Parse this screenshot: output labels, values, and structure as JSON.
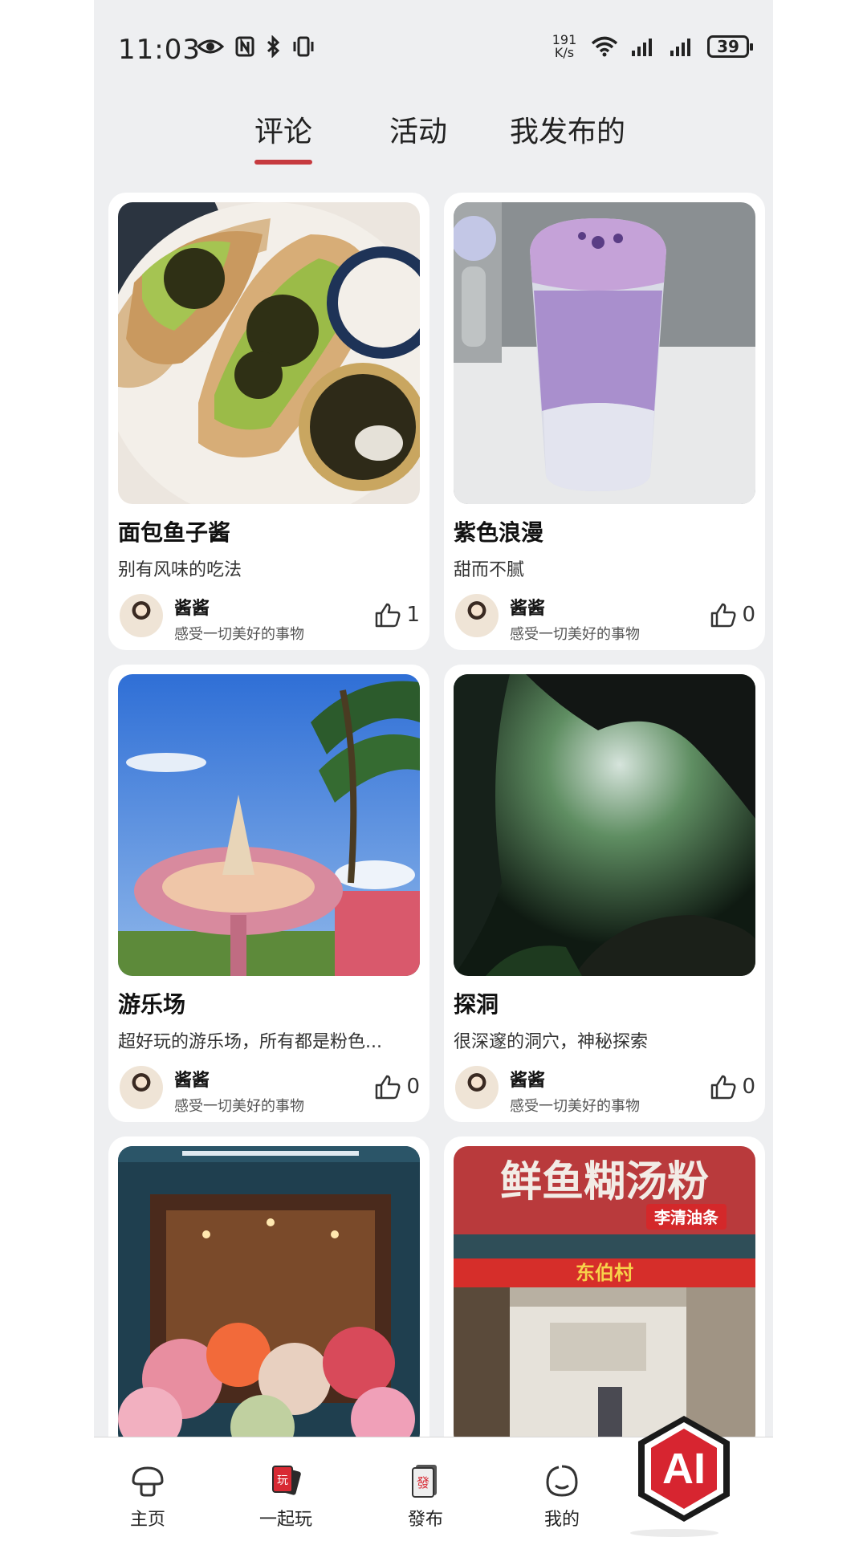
{
  "status_bar": {
    "time": "11:03",
    "net_speed_value": "191",
    "net_speed_unit": "K/s",
    "battery": "39",
    "icons": [
      "eye-icon",
      "nfc-icon",
      "bluetooth-icon",
      "vibrate-icon",
      "wifi-icon",
      "signal-icon",
      "signal-icon",
      "battery-icon"
    ]
  },
  "tabs": [
    {
      "label": "评论",
      "active": true
    },
    {
      "label": "活动",
      "active": false
    },
    {
      "label": "我发布的",
      "active": false
    }
  ],
  "cards": [
    {
      "title": "面包鱼子酱",
      "desc": "别有风味的吃法",
      "author": "酱酱",
      "bio": "感受一切美好的事物",
      "likes": "1",
      "image": "caviar-toast-photo"
    },
    {
      "title": "紫色浪漫",
      "desc": "甜而不腻",
      "author": "酱酱",
      "bio": "感受一切美好的事物",
      "likes": "0",
      "image": "purple-drink-photo"
    },
    {
      "title": "游乐场",
      "desc": "超好玩的游乐场，所有都是粉色...",
      "author": "酱酱",
      "bio": "感受一切美好的事物",
      "likes": "0",
      "image": "amusement-park-photo"
    },
    {
      "title": "探洞",
      "desc": "很深邃的洞穴，神秘探索",
      "author": "酱酱",
      "bio": "感受一切美好的事物",
      "likes": "0",
      "image": "cave-photo"
    },
    {
      "title": "",
      "desc": "",
      "author": "",
      "bio": "",
      "likes": "",
      "image": "flower-shop-photo"
    },
    {
      "title": "",
      "desc": "",
      "author": "",
      "bio": "",
      "likes": "",
      "image": "fish-noodle-shop-photo"
    }
  ],
  "shop_sign": {
    "main": "鲜鱼糊汤粉",
    "sub": "李清油条",
    "banner": "东伯村"
  },
  "bottom_nav": [
    {
      "label": "主页",
      "icon": "mushroom-home-icon"
    },
    {
      "label": "一起玩",
      "icon": "play-cards-icon",
      "badge": "玩"
    },
    {
      "label": "發布",
      "icon": "publish-card-icon",
      "badge": "發"
    },
    {
      "label": "我的",
      "icon": "face-profile-icon"
    }
  ],
  "ai_button": {
    "label": "AI"
  },
  "colors": {
    "accent": "#c63a3f",
    "background": "#eeeff1",
    "card": "#ffffff"
  }
}
